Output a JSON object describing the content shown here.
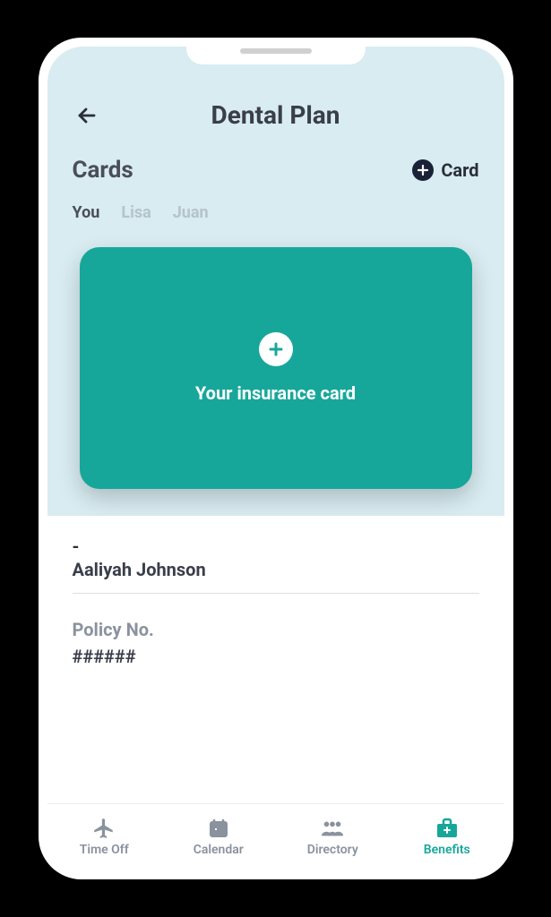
{
  "header": {
    "title": "Dental Plan"
  },
  "cards_section": {
    "title": "Cards",
    "add_label": "Card",
    "tabs": [
      "You",
      "Lisa",
      "Juan"
    ],
    "active_tab": 0,
    "card_label": "Your insurance card"
  },
  "member": {
    "dash": "-",
    "name": "Aaliyah Johnson"
  },
  "policy": {
    "label": "Policy No.",
    "value": "######"
  },
  "nav": {
    "items": [
      {
        "label": "Time Off",
        "icon": "plane"
      },
      {
        "label": "Calendar",
        "icon": "calendar"
      },
      {
        "label": "Directory",
        "icon": "people"
      },
      {
        "label": "Benefits",
        "icon": "briefcase-plus"
      }
    ],
    "active": 3
  },
  "colors": {
    "accent": "#17a79a",
    "dark": "#1a2238",
    "bg_light": "#d8ecf1"
  }
}
